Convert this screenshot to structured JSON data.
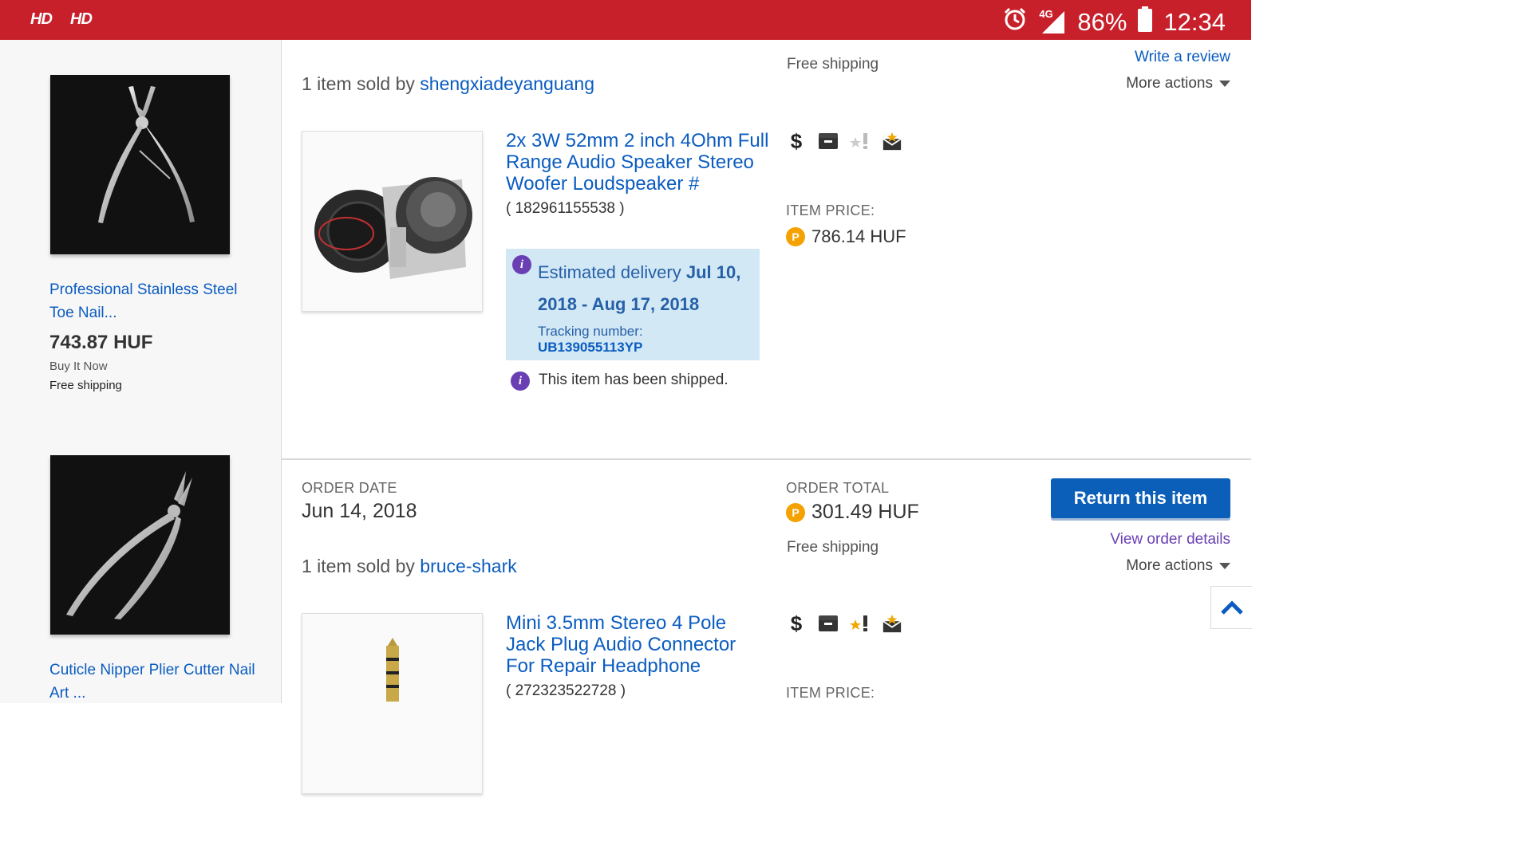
{
  "status_bar": {
    "left_badges": [
      "HD",
      "HD"
    ],
    "network": "4G",
    "battery_percent": "86%",
    "time": "12:34"
  },
  "sidebar": {
    "items": [
      {
        "title": "Professional Stainless Steel Toe Nail...",
        "price": "743.87 HUF",
        "format": "Buy It Now",
        "shipping": "Free shipping"
      },
      {
        "title": "Cuticle Nipper Plier Cutter Nail Art ..."
      }
    ]
  },
  "order1": {
    "shipping": "Free shipping",
    "write_review": "Write a review",
    "more_actions": "More actions",
    "sold_by_prefix": "1 item sold by",
    "seller": "shengxiadeyanguang",
    "item": {
      "title": "2x 3W 52mm 2 inch 4Ohm Full Range Audio Speaker Stereo Woofer Loudspeaker #",
      "number": "( 182961155538 )",
      "price_label": "ITEM PRICE:",
      "price": "786.14 HUF",
      "delivery_prefix": "Estimated delivery",
      "delivery_dates": "Jul 10, 2018 - Aug 17, 2018",
      "tracking_label": "Tracking number:",
      "tracking_number": "UB139055113YP",
      "shipped_status": "This item has been shipped."
    }
  },
  "order2": {
    "order_date_label": "ORDER DATE",
    "order_date": "Jun 14, 2018",
    "order_total_label": "ORDER TOTAL",
    "order_total": "301.49 HUF",
    "shipping": "Free shipping",
    "return_button": "Return this item",
    "view_details": "View order details",
    "more_actions": "More actions",
    "sold_by_prefix": "1 item sold by",
    "seller": "bruce-shark",
    "item": {
      "title": "Mini 3.5mm Stereo 4 Pole Jack Plug Audio Connector For Repair Headphone",
      "number": "( 272323522728 )",
      "price_label": "ITEM PRICE:"
    }
  },
  "colors": {
    "status_bar": "#c8202b",
    "link": "#0a5cc0",
    "button": "#0b5fb8",
    "delivery_bg": "#d3e8f5",
    "info_icon": "#6a3fb4",
    "coin": "#f5a100"
  }
}
